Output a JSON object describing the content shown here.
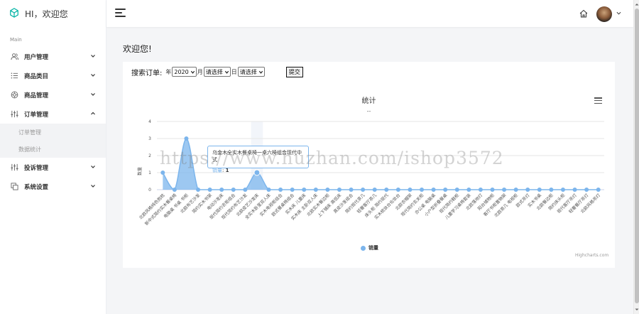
{
  "header": {
    "brand_title": "HI，欢迎您"
  },
  "sidebar": {
    "section_label": "Main",
    "items": [
      {
        "label": "用户管理",
        "icon": "users-icon"
      },
      {
        "label": "商品类目",
        "icon": "list-icon"
      },
      {
        "label": "商品管理",
        "icon": "gear-icon"
      },
      {
        "label": "订单管理",
        "icon": "sliders-icon",
        "expanded": true
      },
      {
        "label": "投诉管理",
        "icon": "sliders-icon"
      },
      {
        "label": "系统设置",
        "icon": "copy-icon"
      }
    ],
    "order_submenu": [
      "订单管理",
      "数据统计"
    ]
  },
  "main": {
    "page_title": "欢迎您!",
    "search": {
      "label": "搜索订单:",
      "year_label": "年",
      "year_value": "2020",
      "month_label": "月",
      "month_value": "请选择",
      "day_label": "日",
      "day_value": "请选择",
      "submit_label": "提交"
    }
  },
  "chart_data": {
    "type": "area",
    "title": "统计",
    "subtitle": "--",
    "ylabel": "数量",
    "ylim": [
      0,
      4
    ],
    "yticks": [
      "0",
      "1",
      "2",
      "3",
      "4"
    ],
    "grid": true,
    "legend_position": "bottom-center",
    "credits": "Highcharts.com",
    "color": "#7cb5ec",
    "categories": [
      "北欧风格纯色抱枕",
      "新中式简约实木餐桌椅",
      "电脑桌 书桌 书柜",
      "北欧布艺沙发",
      "简约实木书架",
      "电动沙发床",
      "现代简约衣柜组合",
      "现代简约布艺沙发",
      "北欧皮艺沙发床",
      "全实木卧室双人床",
      "实木电视柜组合",
      "欧式餐桌椅组合",
      "实木床 儿童床",
      "实木床 主卧双人床",
      "北欧实木餐边柜",
      "上下铺床 高低床",
      "真皮沙发组合",
      "简约现代茶几",
      "轻奢客厅茶几",
      "床头柜 简约现代",
      "实木梳妆台化妆台",
      "北欧衣帽架",
      "现代简约玄关柜",
      "办公桌 电脑桌",
      "小户型折叠餐桌",
      "现代简约鞋柜",
      "儿童学习桌椅套装",
      "北欧落地灯",
      "阳台储物柜",
      "客厅书柜置物架",
      "北欧茶几 电视柜",
      "欧式吊灯",
      "实木书桌",
      "北欧餐边柜",
      "简约床头柜",
      "现代客厅吊灯",
      "轻奢餐厅吊灯",
      "北欧风格吊灯"
    ],
    "values": [
      1,
      0,
      3,
      0,
      0,
      0,
      0,
      0,
      1,
      0,
      0,
      0,
      0,
      0,
      0,
      0,
      0,
      0,
      0,
      0,
      0,
      0,
      0,
      0,
      0,
      0,
      0,
      0,
      0,
      0,
      0,
      0,
      0,
      0,
      0,
      0,
      0,
      0
    ],
    "series": [
      {
        "name": "销量"
      }
    ],
    "tooltip": {
      "title": "乌金木全实木餐桌椅一桌六椅组合现代中式",
      "series": "销量",
      "value": "1"
    }
  },
  "watermark": "https://www.huzhan.com/ishop3572"
}
